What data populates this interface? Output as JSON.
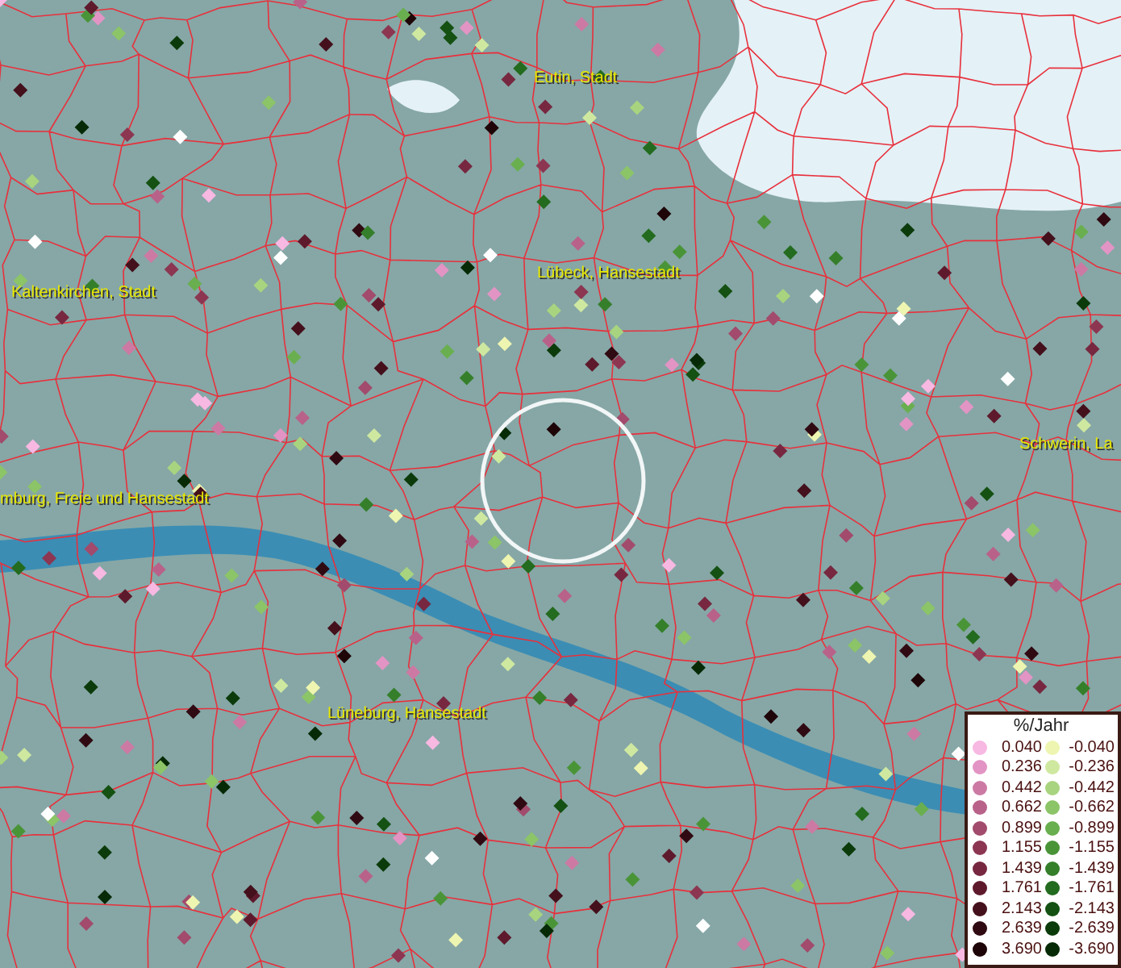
{
  "map": {
    "place_labels": [
      {
        "text": "Eutin, Stadt"
      },
      {
        "text": "Lübeck, Hansestadt"
      },
      {
        "text": "Kaltenkirchen, Stadt"
      },
      {
        "text": "mburg, Freie und Hansestadt"
      },
      {
        "text": "Schwerin, La"
      },
      {
        "text": "Lüneburg, Hansestadt"
      }
    ]
  },
  "legend": {
    "title": "%/Jahr",
    "columns": [
      [
        {
          "value": "0.040",
          "color": "#f7b8e2"
        },
        {
          "value": "0.236",
          "color": "#e294c4"
        },
        {
          "value": "0.442",
          "color": "#cc7aa4"
        },
        {
          "value": "0.662",
          "color": "#b8628a"
        },
        {
          "value": "0.899",
          "color": "#a24b6c"
        },
        {
          "value": "1.155",
          "color": "#8c3652"
        },
        {
          "value": "1.439",
          "color": "#772840"
        },
        {
          "value": "1.761",
          "color": "#5e1a2c"
        },
        {
          "value": "2.143",
          "color": "#44101c"
        },
        {
          "value": "2.639",
          "color": "#300a12"
        },
        {
          "value": "3.690",
          "color": "#1e0508"
        }
      ],
      [
        {
          "value": "-0.040",
          "color": "#eef5b0"
        },
        {
          "value": "-0.236",
          "color": "#cfe8a0"
        },
        {
          "value": "-0.442",
          "color": "#a8d47f"
        },
        {
          "value": "-0.662",
          "color": "#8cc468"
        },
        {
          "value": "-0.899",
          "color": "#6aaf4f"
        },
        {
          "value": "-1.155",
          "color": "#4a9438"
        },
        {
          "value": "-1.439",
          "color": "#357f2a"
        },
        {
          "value": "-1.761",
          "color": "#236b1e"
        },
        {
          "value": "-2.143",
          "color": "#145112"
        },
        {
          "value": "-2.639",
          "color": "#0c3b0b"
        },
        {
          "value": "-3.690",
          "color": "#062a06"
        }
      ]
    ]
  }
}
